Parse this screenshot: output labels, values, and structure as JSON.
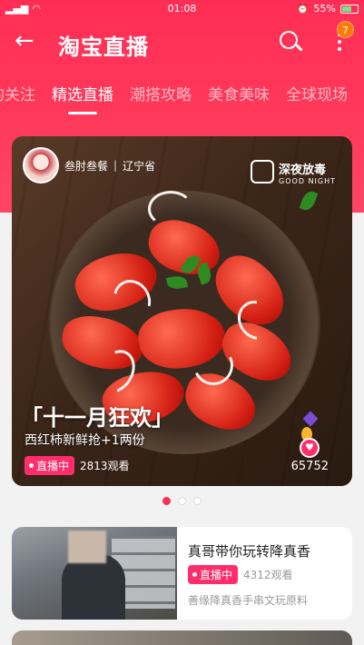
{
  "status_bar": {
    "time": "01:08",
    "battery": "55%"
  },
  "header": {
    "title": "淘宝直播",
    "notification_count": "7"
  },
  "tabs": [
    {
      "label": "的关注",
      "active": false
    },
    {
      "label": "精选直播",
      "active": true
    },
    {
      "label": "潮搭攻略",
      "active": false
    },
    {
      "label": "美食美味",
      "active": false
    },
    {
      "label": "全球现场",
      "active": false
    }
  ],
  "featured": {
    "host_name": "叁肘叁餐",
    "location": "辽宁省",
    "brand_cn": "深夜放毒",
    "brand_en": "GOOD NIGHT",
    "promo_title": "「十一月狂欢」",
    "promo_subtitle": "西红柿新鲜抢+1两份",
    "live_label": "直播中",
    "viewers": "2813观看",
    "likes": "65752"
  },
  "carousel": {
    "page_count": 3,
    "active_index": 0
  },
  "list": [
    {
      "title": "真哥带你玩转降真香",
      "live_label": "直播中",
      "viewers": "4312观看",
      "desc": "善缘降真香手串文玩原料"
    }
  ],
  "colors": {
    "accent": "#ff2d55",
    "live_badge": "#ff2d6c"
  }
}
